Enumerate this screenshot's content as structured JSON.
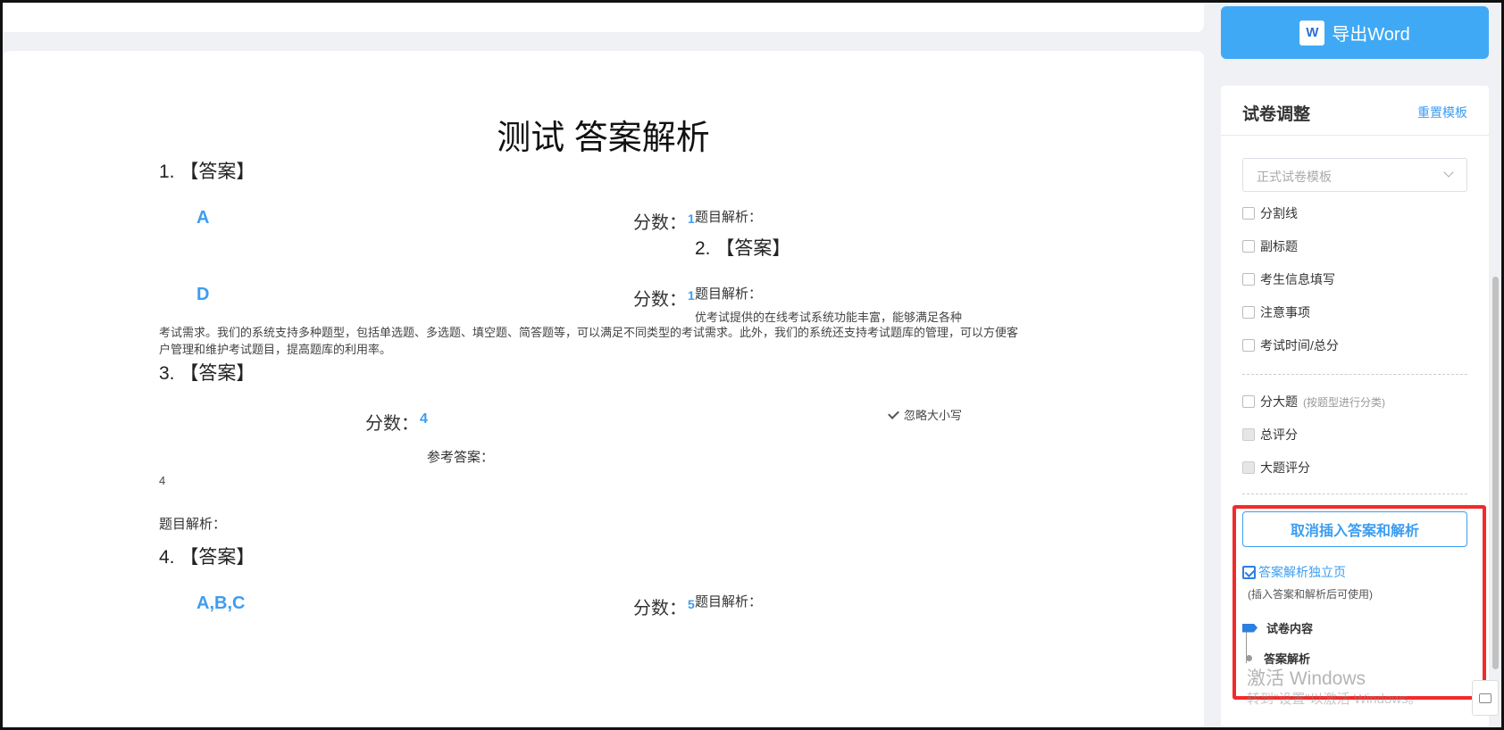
{
  "paper": {
    "title": "测试 答案解析",
    "score_label": "分数：",
    "analysis_label": "题目解析：",
    "reference_label": "参考答案：",
    "q1": {
      "head": "1. 【答案】",
      "answer": "A",
      "score": "1"
    },
    "q2": {
      "head": "2. 【答案】",
      "answer": "D",
      "score": "1",
      "analysis_line1": "优考试提供的在线考试系统功能丰富，能够满足各种",
      "analysis_para": "考试需求。我们的系统支持多种题型，包括单选题、多选题、填空题、简答题等，可以满足不同类型的考试需求。此外，我们的系统还支持考试题库的管理，可以方便客户管理和维护考试题目，提高题库的利用率。"
    },
    "q3": {
      "head": "3. 【答案】",
      "score": "4",
      "ignore_case": "忽略大小写",
      "reference_value": "4"
    },
    "q4": {
      "head": "4. 【答案】",
      "answer": "A,B,C",
      "score": "5"
    }
  },
  "sidebar": {
    "export_label": "导出Word",
    "word_icon_letter": "W",
    "panel_title": "试卷调整",
    "reset_label": "重置模板",
    "template_select": "正式试卷模板",
    "options": [
      "分割线",
      "副标题",
      "考生信息填写",
      "注意事项",
      "考试时间/总分"
    ],
    "group_option": "分大题",
    "group_hint": "(按题型进行分类)",
    "total_score": "总评分",
    "section_score": "大题评分",
    "cancel_button": "取消插入答案和解析",
    "independent_page": "答案解析独立页",
    "independent_note": "(插入答案和解析后可使用)",
    "step_content": "试卷内容",
    "step_analysis": "答案解析"
  },
  "watermark": {
    "line1": "激活 Windows",
    "line2": "转到\"设置\"以激活 Windows。"
  },
  "colors": {
    "accent": "#3d9df0",
    "export_bg": "#40a9f5",
    "highlight": "#f12b2b"
  }
}
